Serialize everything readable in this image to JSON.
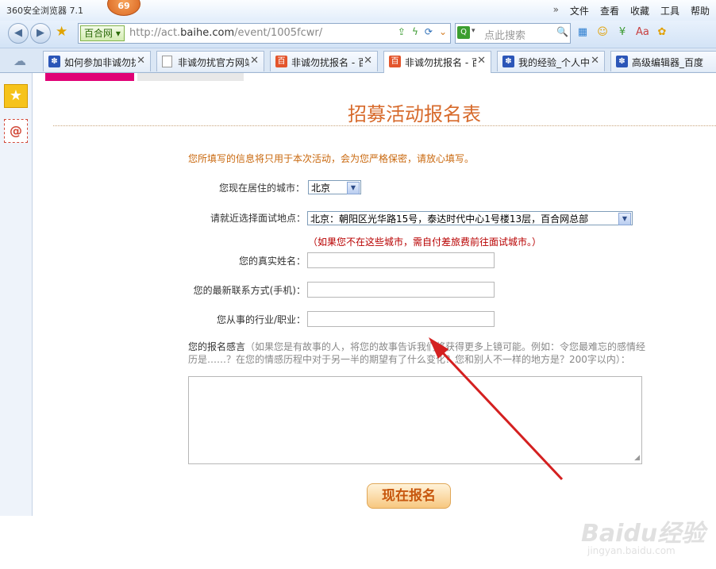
{
  "titlebar": {
    "app_title": "360安全浏览器 7.1",
    "badge": "69",
    "menu_chevron": "»",
    "menus": [
      "文件",
      "查看",
      "收藏",
      "工具",
      "帮助"
    ]
  },
  "toolbar": {
    "back_icon": "back-arrow-icon",
    "forward_icon": "forward-arrow-icon",
    "site_chip": "百合网",
    "url_prefix": "http://act.",
    "url_domain": "baihe.com",
    "url_path": "/event/1005fcwr/",
    "search_placeholder": "点此搜索"
  },
  "tabs": [
    {
      "label": "如何参加非诚勿扰",
      "icon": "paw"
    },
    {
      "label": "非诚勿扰官方网站",
      "icon": "page"
    },
    {
      "label": "非诚勿扰报名 - 百合网",
      "icon": "baihe"
    },
    {
      "label": "非诚勿扰报名 - 百合网",
      "icon": "baihe",
      "active": true
    },
    {
      "label": "我的经验_个人中心",
      "icon": "paw"
    },
    {
      "label": "高级编辑器_百度经验",
      "icon": "paw"
    }
  ],
  "form": {
    "title": "招募活动报名表",
    "notice": "您所填写的信息将只用于本次活动，会为您严格保密，请放心填写。",
    "city_label": "您现在居住的城市：",
    "city_value": "北京",
    "location_label": "请就近选择面试地点：",
    "location_value": "北京：朝阳区光华路15号，泰达时代中心1号楼13层，百合网总部",
    "location_warning": "（如果您不在这些城市，需自付差旅费前往面试城市。）",
    "name_label": "您的真实姓名：",
    "phone_label": "您的最新联系方式(手机)：",
    "job_label": "您从事的行业/职业：",
    "essay_label": "您的报名感言",
    "essay_hint": "（如果您是有故事的人，将您的故事告诉我们将获得更多上镜可能。例如：令您最难忘的感情经历是……？在您的情感历程中对于另一半的期望有了什么变化？您和别人不一样的地方是？200字以内）：",
    "submit_label": "现在报名"
  },
  "watermark": {
    "brand": "Baidu经验",
    "sub": "jingyan.baidu.com"
  },
  "colors": {
    "accent_orange": "#d76a2b",
    "warning_red": "#b80000",
    "strip_pink": "#e00075",
    "annotation_arrow": "#d42020"
  }
}
